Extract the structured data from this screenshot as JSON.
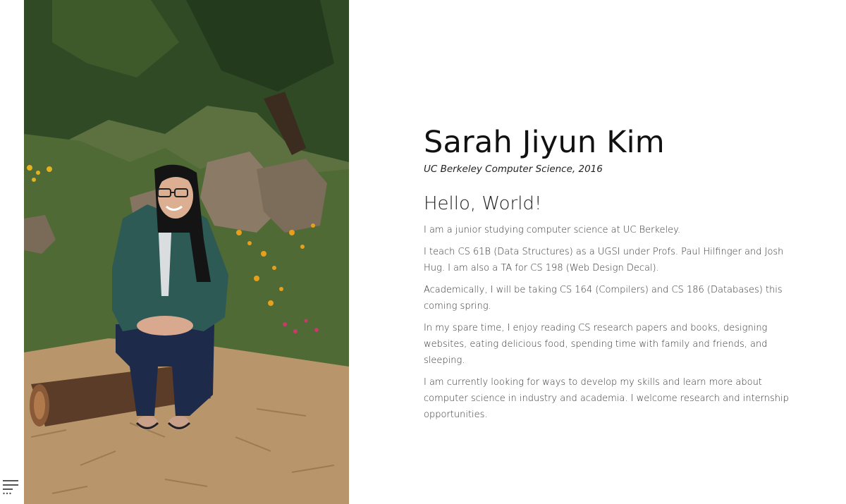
{
  "sidebar": {
    "menu_icon": "hamburger-menu-icon"
  },
  "photo": {
    "subject": "portrait-photo"
  },
  "profile": {
    "name": "Sarah Jiyun Kim",
    "subtitle": "UC Berkeley Computer Science, 2016"
  },
  "about": {
    "heading": "Hello, World!",
    "paragraphs": [
      "I am a junior studying computer science at UC Berkeley.",
      "I teach CS 61B (Data Structures) as a UGSI under Profs. Paul Hilfinger and Josh Hug. I am also a TA for CS 198 (Web Design Decal).",
      "Academically, I will be taking CS 164 (Compilers) and CS 186 (Databases) this coming spring.",
      "In my spare time, I enjoy reading CS research papers and books, designing websites, eating delicious food, spending time with family and friends, and sleeping.",
      "I am currently looking for ways to develop my skills and learn more about computer science in industry and academia. I welcome research and internship opportunities."
    ]
  },
  "colors": {
    "text": "#333333",
    "heading": "#111111",
    "background": "#ffffff"
  }
}
